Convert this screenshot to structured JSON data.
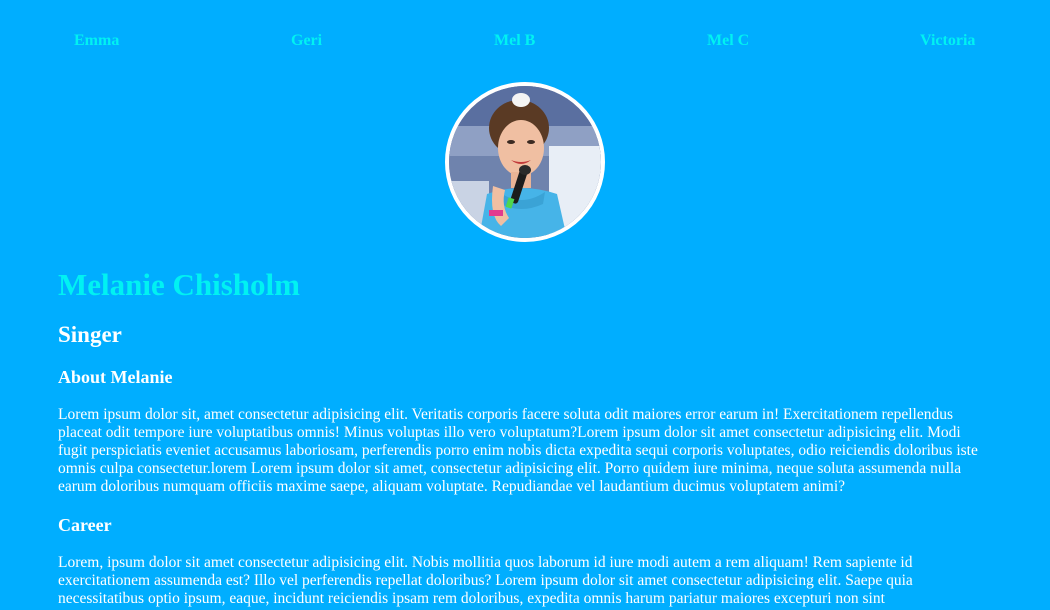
{
  "nav": {
    "items": [
      {
        "label": "Emma"
      },
      {
        "label": "Geri"
      },
      {
        "label": "Mel B"
      },
      {
        "label": "Mel C"
      },
      {
        "label": "Victoria"
      }
    ]
  },
  "profile": {
    "photo_icon": "singer-photo",
    "name": "Melanie Chisholm",
    "role": "Singer"
  },
  "about": {
    "heading": "About Melanie",
    "text": "Lorem ipsum dolor sit, amet consectetur adipisicing elit. Veritatis corporis facere soluta odit maiores error earum in! Exercitationem repellendus placeat odit tempore iure voluptatibus omnis! Minus voluptas illo vero voluptatum?Lorem ipsum dolor sit amet consectetur adipisicing elit. Modi fugit perspiciatis eveniet accusamus laboriosam, perferendis porro enim nobis dicta expedita sequi corporis voluptates, odio reiciendis doloribus iste omnis culpa consectetur.lorem Lorem ipsum dolor sit amet, consectetur adipisicing elit. Porro quidem iure minima, neque soluta assumenda nulla earum doloribus numquam officiis maxime saepe, aliquam voluptate. Repudiandae vel laudantium ducimus voluptatem animi?"
  },
  "career": {
    "heading": "Career",
    "text": "Lorem, ipsum dolor sit amet consectetur adipisicing elit. Nobis mollitia quos laborum id iure modi autem a rem aliquam! Rem sapiente id exercitationem assumenda est? Illo vel perferendis repellat doloribus? Lorem ipsum dolor sit amet consectetur adipisicing elit. Saepe quia necessitatibus optio ipsum, eaque, incidunt reiciendis ipsam rem doloribus, expedita omnis harum pariatur maiores excepturi non sint"
  },
  "colors": {
    "background": "#00aeff",
    "accent": "#00f2f2",
    "text": "#ffffff"
  }
}
